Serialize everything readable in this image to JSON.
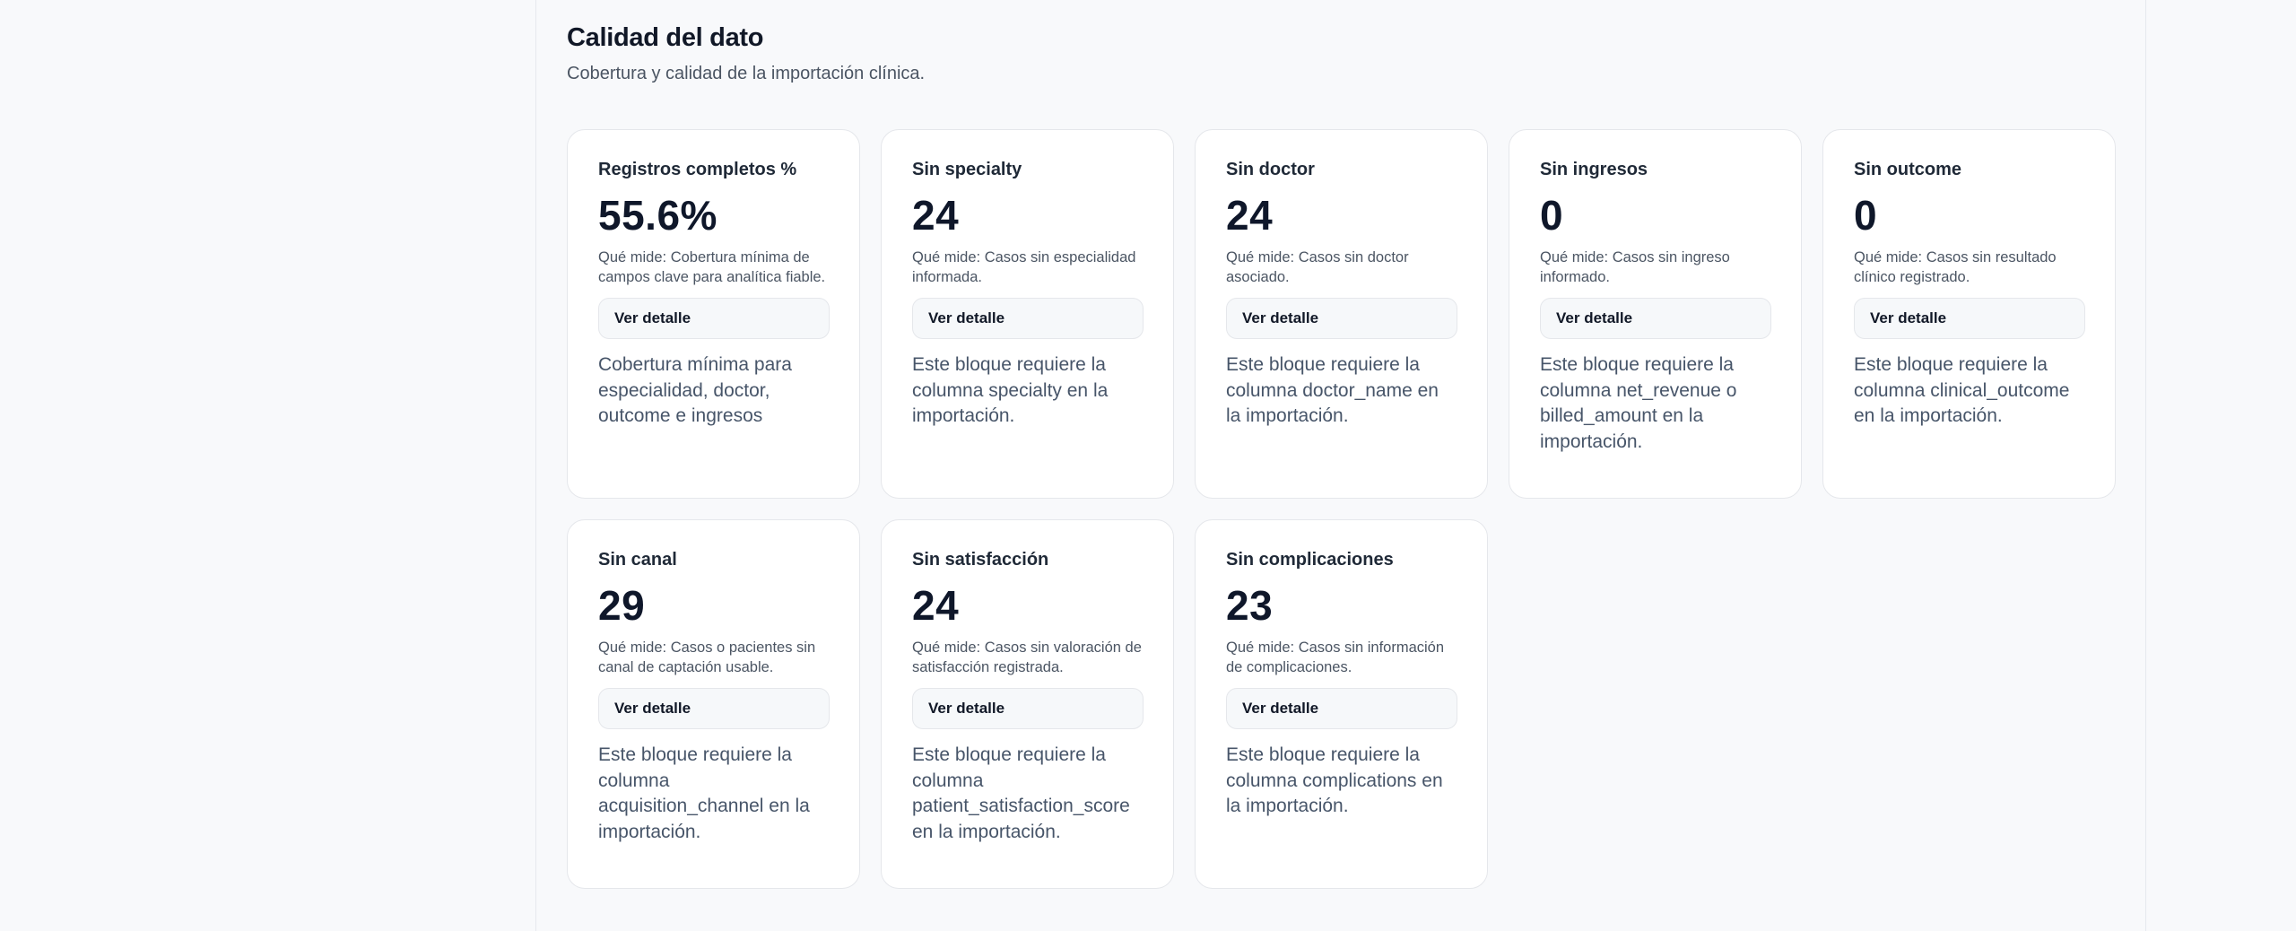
{
  "section": {
    "title": "Calidad del dato",
    "subtitle": "Cobertura y calidad de la importación clínica."
  },
  "cards": [
    {
      "label": "Registros completos %",
      "value": "55.6%",
      "description": "Qué mide: Cobertura mínima de campos clave para analítica fiable.",
      "button": "Ver detalle",
      "note": "Cobertura mínima para especialidad, doctor, outcome e ingresos"
    },
    {
      "label": "Sin specialty",
      "value": "24",
      "description": "Qué mide: Casos sin especialidad informada.",
      "button": "Ver detalle",
      "note": "Este bloque requiere la columna specialty en la importación."
    },
    {
      "label": "Sin doctor",
      "value": "24",
      "description": "Qué mide: Casos sin doctor asociado.",
      "button": "Ver detalle",
      "note": "Este bloque requiere la columna doctor_name en la importación."
    },
    {
      "label": "Sin ingresos",
      "value": "0",
      "description": "Qué mide: Casos sin ingreso informado.",
      "button": "Ver detalle",
      "note": "Este bloque requiere la columna net_revenue o billed_amount en la importación."
    },
    {
      "label": "Sin outcome",
      "value": "0",
      "description": "Qué mide: Casos sin resultado clínico registrado.",
      "button": "Ver detalle",
      "note": "Este bloque requiere la columna clinical_outcome en la importación."
    },
    {
      "label": "Sin canal",
      "value": "29",
      "description": "Qué mide: Casos o pacientes sin canal de captación usable.",
      "button": "Ver detalle",
      "note": "Este bloque requiere la columna acquisition_channel en la importación."
    },
    {
      "label": "Sin satisfacción",
      "value": "24",
      "description": "Qué mide: Casos sin valoración de satisfacción registrada.",
      "button": "Ver detalle",
      "note": "Este bloque requiere la columna patient_satisfaction_score en la importación."
    },
    {
      "label": "Sin complicaciones",
      "value": "23",
      "description": "Qué mide: Casos sin información de complicaciones.",
      "button": "Ver detalle",
      "note": "Este bloque requiere la columna complications en la importación."
    }
  ]
}
